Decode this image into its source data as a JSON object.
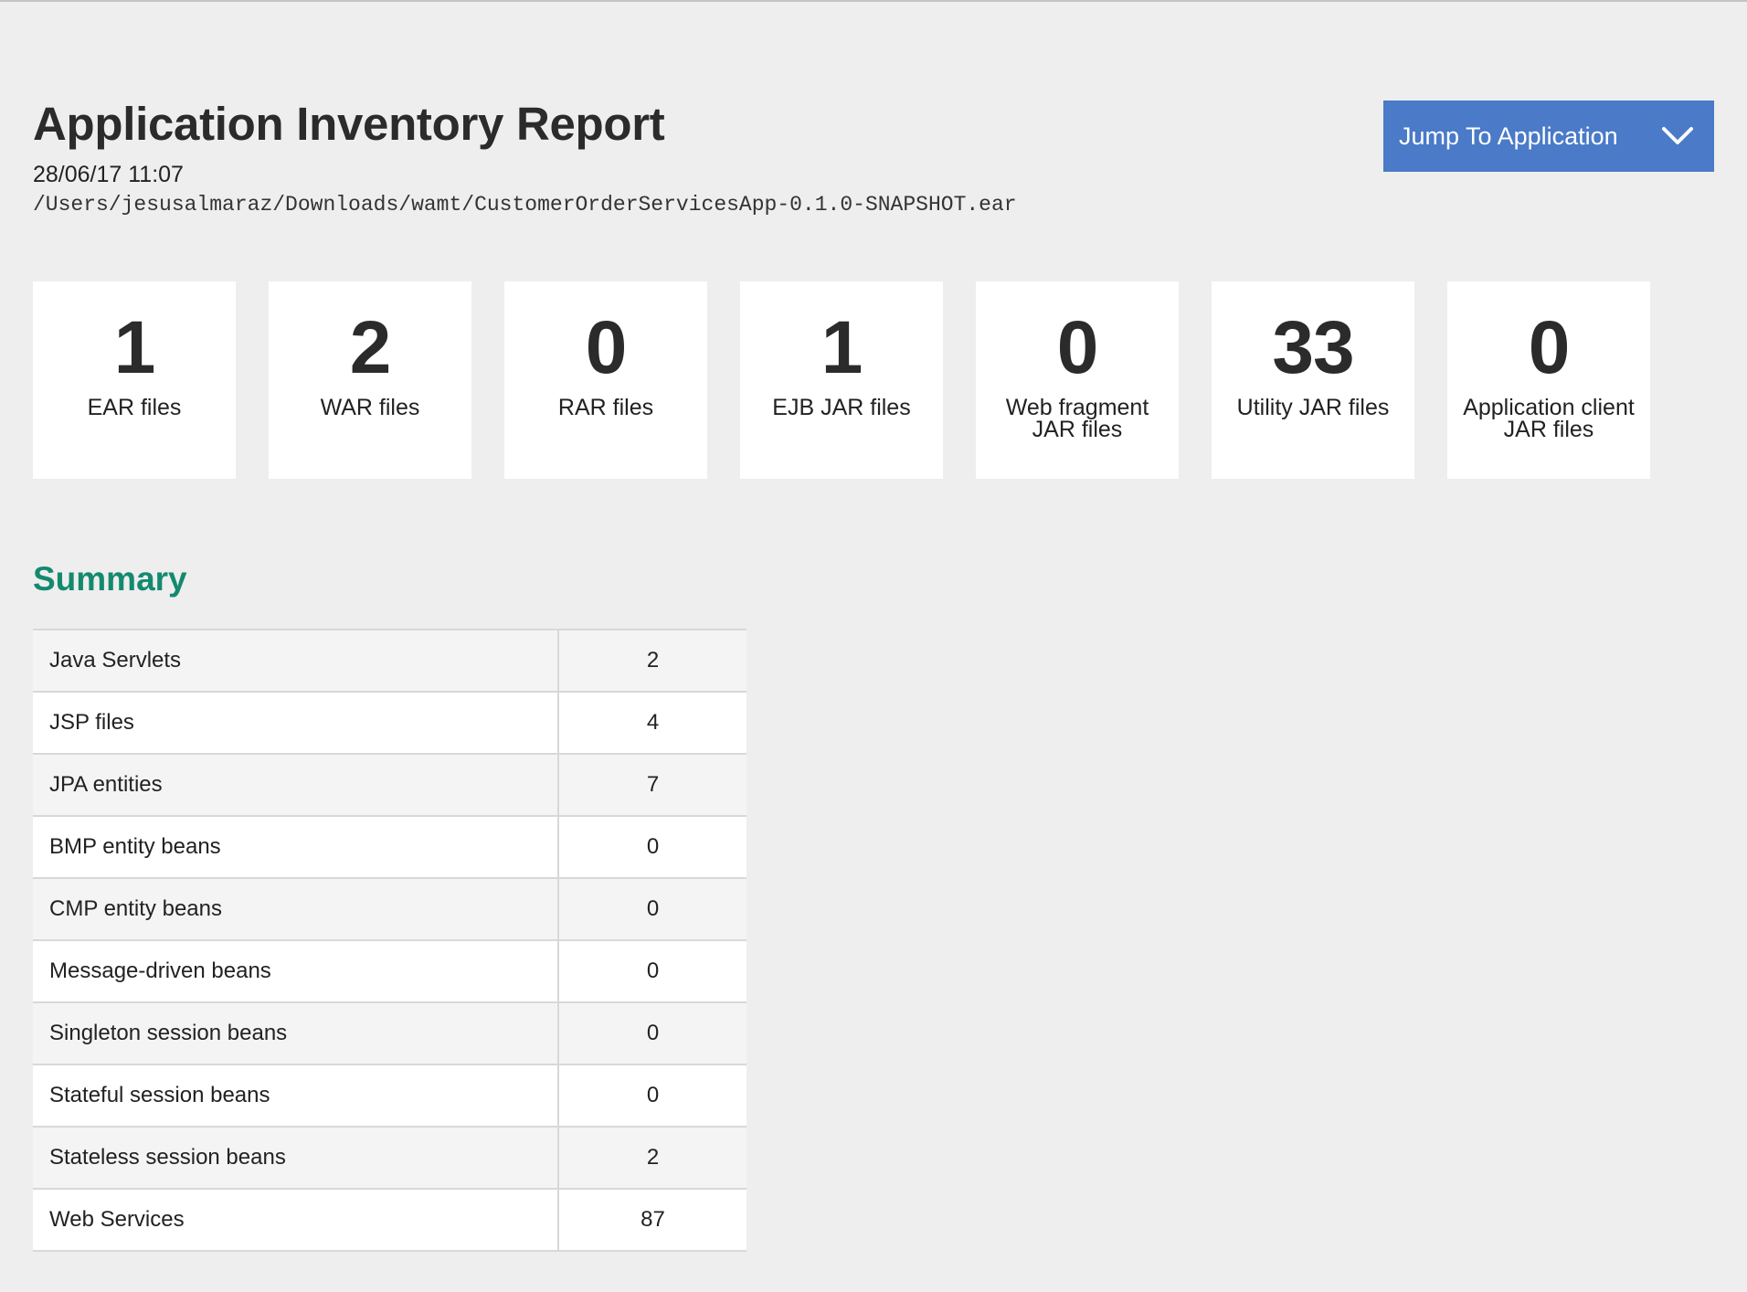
{
  "header": {
    "title": "Application Inventory Report",
    "timestamp": "28/06/17 11:07",
    "path": "/Users/jesusalmaraz/Downloads/wamt/CustomerOrderServicesApp-0.1.0-SNAPSHOT.ear"
  },
  "jump": {
    "label": "Jump To Application",
    "icon": "chevron-down-icon"
  },
  "stats": [
    {
      "value": "1",
      "label": "EAR files"
    },
    {
      "value": "2",
      "label": "WAR files"
    },
    {
      "value": "0",
      "label": "RAR files"
    },
    {
      "value": "1",
      "label": "EJB JAR files"
    },
    {
      "value": "0",
      "label": "Web fragment JAR files"
    },
    {
      "value": "33",
      "label": "Utility JAR files"
    },
    {
      "value": "0",
      "label": "Application client JAR files"
    }
  ],
  "summary": {
    "title": "Summary",
    "rows": [
      {
        "name": "Java Servlets",
        "count": "2"
      },
      {
        "name": "JSP files",
        "count": "4"
      },
      {
        "name": "JPA entities",
        "count": "7"
      },
      {
        "name": "BMP entity beans",
        "count": "0"
      },
      {
        "name": "CMP entity beans",
        "count": "0"
      },
      {
        "name": "Message-driven beans",
        "count": "0"
      },
      {
        "name": "Singleton session beans",
        "count": "0"
      },
      {
        "name": "Stateful session beans",
        "count": "0"
      },
      {
        "name": "Stateless session beans",
        "count": "2"
      },
      {
        "name": "Web Services",
        "count": "87"
      }
    ]
  },
  "colors": {
    "background": "#eeeeee",
    "button": "#4a7ac8",
    "summary_heading": "#138a6e",
    "card": "#ffffff"
  }
}
